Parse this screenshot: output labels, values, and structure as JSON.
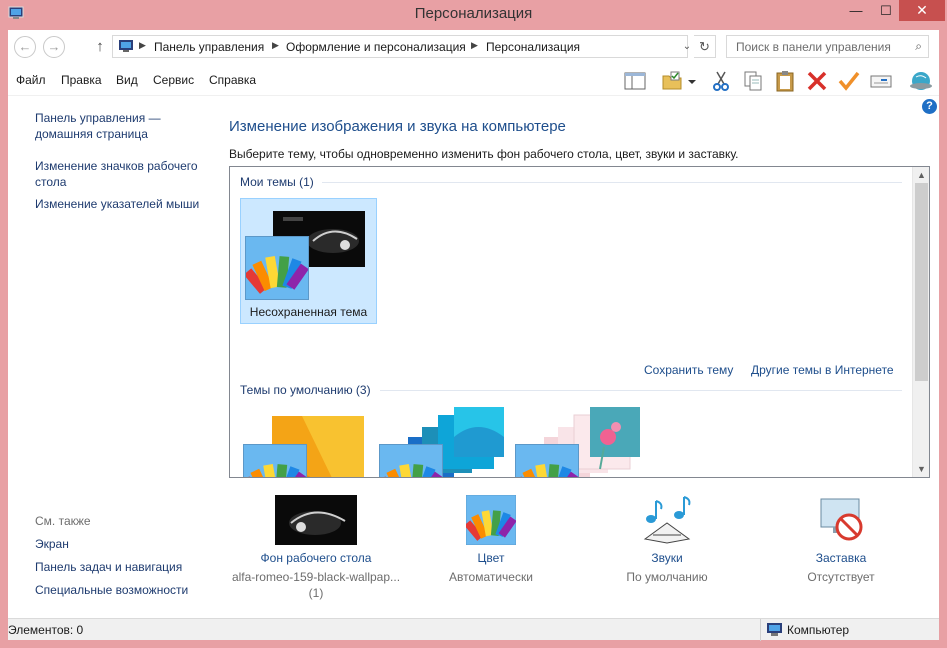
{
  "window": {
    "title": "Персонализация",
    "minimize_glyph": "—",
    "maximize_glyph": "☐",
    "close_glyph": "✕"
  },
  "nav": {
    "breadcrumbs": [
      "Панель управления",
      "Оформление и персонализация",
      "Персонализация"
    ],
    "search_placeholder": "Поиск в панели управления"
  },
  "menu": {
    "items": [
      "Файл",
      "Правка",
      "Вид",
      "Сервис",
      "Справка"
    ]
  },
  "toolbar": {
    "icons": [
      "layout-icon",
      "properties-folder-icon",
      "cut-icon",
      "copy-icon",
      "paste-icon",
      "delete-icon",
      "checkmark-icon",
      "keyboard-icon",
      "globe-icon"
    ]
  },
  "left_pane": {
    "home_link": "Панель управления — домашняя страница",
    "links": [
      "Изменение значков рабочего стола",
      "Изменение указателей мыши"
    ],
    "see_also_header": "См. также",
    "see_also": [
      "Экран",
      "Панель задач и навигация",
      "Специальные возможности"
    ]
  },
  "main": {
    "heading": "Изменение изображения и звука на компьютере",
    "subheading": "Выберите тему, чтобы одновременно изменить фон рабочего стола, цвет, звуки и заставку.",
    "my_themes_title": "Мои темы (1)",
    "my_themes": [
      {
        "name": "Несохраненная тема",
        "selected": true
      }
    ],
    "save_theme": "Сохранить тему",
    "online_themes": "Другие темы в Интернете",
    "default_themes_title": "Темы по умолчанию (3)"
  },
  "settings": [
    {
      "title": "Фон рабочего стола",
      "value": "alfa-romeo-159-black-wallpap...",
      "value2": "(1)",
      "icon": "wallpaper-thumbnail-icon"
    },
    {
      "title": "Цвет",
      "value": "Автоматически",
      "icon": "color-palette-icon"
    },
    {
      "title": "Звуки",
      "value": "По умолчанию",
      "icon": "music-notes-icon"
    },
    {
      "title": "Заставка",
      "value": "Отсутствует",
      "icon": "screensaver-none-icon"
    }
  ],
  "status": {
    "items": "Элементов: 0",
    "location": "Компьютер"
  },
  "colors": {
    "title_bar": "#e8a0a4",
    "link": "#1e4e8c",
    "selection": "#cce8ff",
    "close_button": "#c7504f"
  }
}
